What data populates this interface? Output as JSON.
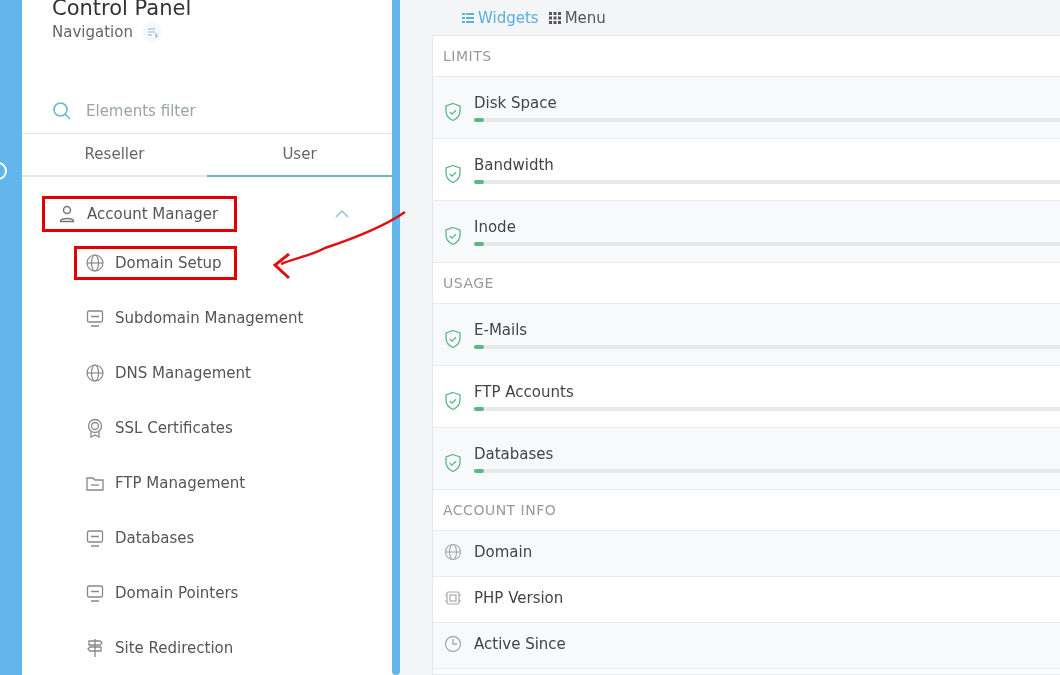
{
  "sidebar": {
    "title": "Control Panel",
    "subtitle": "Navigation",
    "filter": {
      "placeholder": "Elements filter"
    },
    "tabs": [
      {
        "label": "Reseller",
        "selected": false
      },
      {
        "label": "User",
        "selected": true
      }
    ],
    "group": {
      "label": "Account Manager",
      "expanded": true,
      "highlighted": true,
      "children": [
        {
          "label": "Domain Setup",
          "highlighted": true
        },
        {
          "label": "Subdomain Management",
          "highlighted": false
        },
        {
          "label": "DNS Management",
          "highlighted": false
        },
        {
          "label": "SSL Certificates",
          "highlighted": false
        },
        {
          "label": "FTP Management",
          "highlighted": false
        },
        {
          "label": "Databases",
          "highlighted": false
        },
        {
          "label": "Domain Pointers",
          "highlighted": false
        },
        {
          "label": "Site Redirection",
          "highlighted": false
        }
      ]
    }
  },
  "view_toggle": [
    {
      "label": "Widgets",
      "selected": true
    },
    {
      "label": "Menu",
      "selected": false
    }
  ],
  "sections": [
    {
      "title": "LIMITS",
      "rows": [
        {
          "kind": "meter",
          "label": "Disk Space",
          "level": 0.015
        },
        {
          "kind": "meter",
          "label": "Bandwidth",
          "level": 0.015
        },
        {
          "kind": "meter",
          "label": "Inode",
          "level": 0.015
        }
      ]
    },
    {
      "title": "USAGE",
      "rows": [
        {
          "kind": "meter",
          "label": "E-Mails",
          "level": 0.015
        },
        {
          "kind": "meter",
          "label": "FTP Accounts",
          "level": 0.015
        },
        {
          "kind": "meter",
          "label": "Databases",
          "level": 0.015
        }
      ]
    },
    {
      "title": "ACCOUNT INFO",
      "rows": [
        {
          "kind": "info",
          "label": "Domain"
        },
        {
          "kind": "info",
          "label": "PHP Version"
        },
        {
          "kind": "info",
          "label": "Active Since"
        }
      ]
    }
  ]
}
